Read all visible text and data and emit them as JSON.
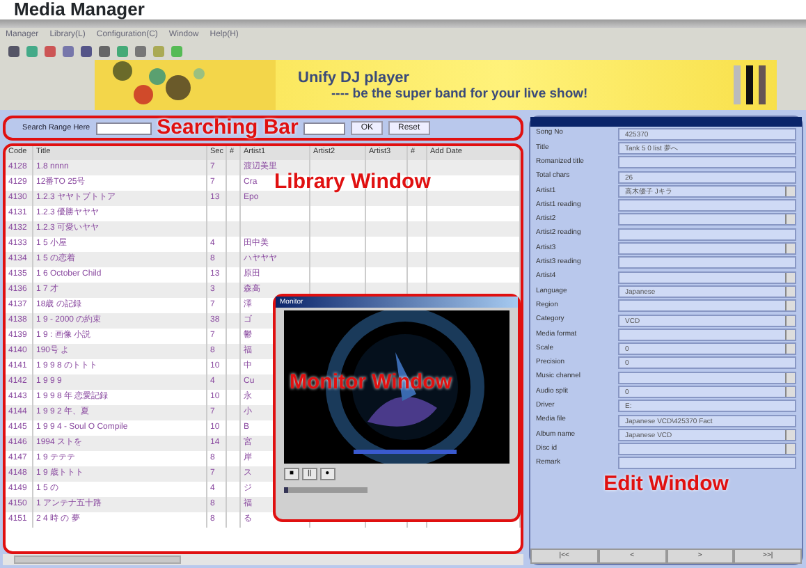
{
  "heading": "Media Manager",
  "menu": [
    "Manager",
    "Library(L)",
    "Configuration(C)",
    "Window",
    "Help(H)"
  ],
  "banner": {
    "line1": "Unify DJ player",
    "line2": "---- be the super band for your live show!"
  },
  "search": {
    "label": "Search Range Here",
    "buttons": [
      "OK",
      "Reset"
    ]
  },
  "table": {
    "columns": [
      "Code",
      "Title",
      "Sec",
      "#",
      "Artist1",
      "Artist2",
      "Artist3",
      "#",
      "Add Date"
    ],
    "rows": [
      {
        "code": "4128",
        "title": "1.8 nnnn",
        "sec": "7",
        "artist": "渡辺美里"
      },
      {
        "code": "4129",
        "title": "12番TO 25号",
        "sec": "7",
        "artist": "Cra"
      },
      {
        "code": "4130",
        "title": "1.2.3 ヤヤトプトトア",
        "sec": "13",
        "artist": "Epo"
      },
      {
        "code": "4131",
        "title": "1.2.3 優勝ヤヤヤ"
      },
      {
        "code": "4132",
        "title": "1.2.3 可愛いヤヤ"
      },
      {
        "code": "4133",
        "title": "1 5 小屋",
        "sec": "4",
        "artist": "田中美"
      },
      {
        "code": "4134",
        "title": "1 5 の恋着",
        "sec": "8",
        "artist": "ハヤヤヤ"
      },
      {
        "code": "4135",
        "title": "1 6 October Child",
        "sec": "13",
        "artist": "原田"
      },
      {
        "code": "4136",
        "title": "1 7 才",
        "sec": "3",
        "artist": "森高"
      },
      {
        "code": "4137",
        "title": "18歳 の記録",
        "sec": "7",
        "artist": "澤"
      },
      {
        "code": "4138",
        "title": "1 9 - 2000 の約束",
        "sec": "38",
        "artist": "ゴ"
      },
      {
        "code": "4139",
        "title": "1 9 : 画像 小説",
        "sec": "7",
        "artist": "鬱"
      },
      {
        "code": "4140",
        "title": "190号 よ",
        "sec": "8",
        "artist": "福"
      },
      {
        "code": "4141",
        "title": "1 9 9 8 のトトト",
        "sec": "10",
        "artist": "中"
      },
      {
        "code": "4142",
        "title": "1 9 9 9",
        "sec": "4",
        "artist": "Cu"
      },
      {
        "code": "4143",
        "title": "1 9 9 8 年 恋愛記録",
        "sec": "10",
        "artist": "永"
      },
      {
        "code": "4144",
        "title": "1 9 9 2 年、夏",
        "sec": "7",
        "artist": "小"
      },
      {
        "code": "4145",
        "title": "1 9 9 4 - Soul O Compile",
        "sec": "10",
        "artist": "B"
      },
      {
        "code": "4146",
        "title": "1994 ストを",
        "sec": "14",
        "artist": "宮"
      },
      {
        "code": "4147",
        "title": "1 9 テテテ",
        "sec": "8",
        "artist": "岸"
      },
      {
        "code": "4148",
        "title": "1 9 歳トトト",
        "sec": "7",
        "artist": "ス"
      },
      {
        "code": "4149",
        "title": "1 5 の",
        "sec": "4",
        "artist": "ジ"
      },
      {
        "code": "4150",
        "title": "1 アンテナ五十路",
        "sec": "8",
        "artist": "福"
      },
      {
        "code": "4151",
        "title": "2 4 時 の 夢",
        "sec": "8",
        "artist": "る"
      }
    ]
  },
  "monitor": {
    "title": "Monitor",
    "controls": [
      "■",
      "||",
      "●"
    ],
    "seek": {
      "level": 0.05
    }
  },
  "edit": {
    "fields": [
      {
        "label": "Song No",
        "value": "425370",
        "kind": "text"
      },
      {
        "label": "Title",
        "value": "Tank 5 0 list 夢へ",
        "kind": "text"
      },
      {
        "label": "Romanized title",
        "kind": "text"
      },
      {
        "label": "Total chars",
        "value": "26",
        "kind": "text"
      },
      {
        "label": "Artist1",
        "value": "高木優子 Jキラ",
        "kind": "select"
      },
      {
        "label": "Artist1 reading",
        "kind": "text"
      },
      {
        "label": "Artist2",
        "kind": "select"
      },
      {
        "label": "Artist2 reading",
        "kind": "text"
      },
      {
        "label": "Artist3",
        "kind": "select"
      },
      {
        "label": "Artist3 reading",
        "kind": "text"
      },
      {
        "label": "Artist4",
        "kind": "select"
      },
      {
        "label": "Language",
        "value": "Japanese",
        "kind": "select"
      },
      {
        "label": "Region",
        "kind": "select"
      },
      {
        "label": "Category",
        "value": "VCD",
        "kind": "select"
      },
      {
        "label": "Media format",
        "kind": "select"
      },
      {
        "label": "Scale",
        "value": "0",
        "kind": "select"
      },
      {
        "label": "Precision",
        "value": "0",
        "kind": "text"
      },
      {
        "label": "Music channel",
        "kind": "select"
      },
      {
        "label": "Audio split",
        "value": "0",
        "kind": "select"
      },
      {
        "label": "Driver",
        "value": "E:",
        "kind": "text"
      },
      {
        "label": "Media file",
        "value": "Japanese VCD\\425370 Fact",
        "kind": "text"
      },
      {
        "label": "Album name",
        "value": "Japanese VCD",
        "kind": "select"
      },
      {
        "label": "Disc id",
        "kind": "select"
      },
      {
        "label": "Remark",
        "kind": "text"
      }
    ],
    "nav": [
      "|<<",
      "<",
      ">",
      ">>|"
    ]
  },
  "annotations": [
    "Searching Bar",
    "Library Window",
    "Monitor Window",
    "Edit Window"
  ]
}
